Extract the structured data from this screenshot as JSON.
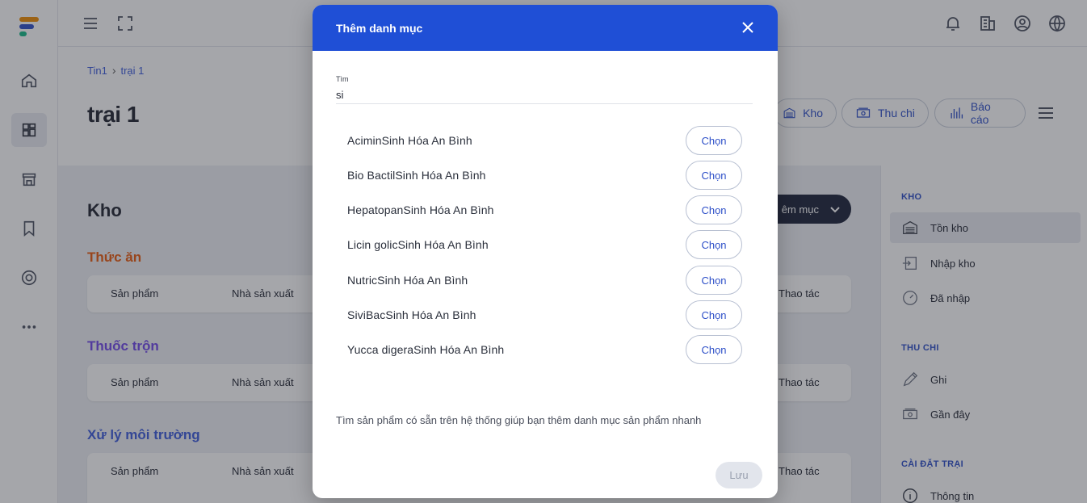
{
  "topbar": {
    "icons": [
      "menu-icon",
      "fullscreen-icon",
      "bell-icon",
      "building-icon",
      "user-circle-icon",
      "globe-icon"
    ]
  },
  "rail": {
    "icons": [
      "home-icon",
      "dashboard-icon",
      "store-icon",
      "bookmark-icon",
      "support-icon",
      "more-icon"
    ]
  },
  "breadcrumb": {
    "root": "Tin1",
    "current": "trại 1"
  },
  "page": {
    "title": "trại 1"
  },
  "tabs": [
    {
      "label": "Kho",
      "icon": "warehouse-icon"
    },
    {
      "label": "Thu chi",
      "icon": "money-icon"
    },
    {
      "label": "Báo cáo",
      "icon": "chart-icon"
    }
  ],
  "main": {
    "section_title": "Kho",
    "add_button": "êm mục",
    "categories": [
      {
        "title": "Thức ăn",
        "color": "#e8590c"
      },
      {
        "title": "Thuốc trộn",
        "color": "#7048e8"
      },
      {
        "title": "Xử lý môi trường",
        "color": "#3b5bdb"
      }
    ],
    "columns": {
      "product": "Sản phẩm",
      "maker": "Nhà sản xuất",
      "actions": "Thao tác"
    }
  },
  "right_panel": {
    "groups": [
      {
        "title": "KHO",
        "items": [
          "Tồn kho",
          "Nhập kho",
          "Đã nhập"
        ]
      },
      {
        "title": "THU CHI",
        "items": [
          "Ghi",
          "Gần đây"
        ]
      },
      {
        "title": "CÀI ĐẶT TRẠI",
        "items": [
          "Thông tin"
        ]
      }
    ]
  },
  "modal": {
    "title": "Thêm danh mục",
    "search_label": "Tìm",
    "search_value": "si",
    "choose_label": "Chọn",
    "results": [
      "AciminSinh Hóa An Bình",
      "Bio BactilSinh Hóa An Bình",
      "HepatopanSinh Hóa An Bình",
      "Licin golicSinh Hóa An Bình",
      "NutricSinh Hóa An Bình",
      "SiviBacSinh Hóa An Bình",
      "Yucca digeraSinh Hóa An Bình"
    ],
    "hint": "Tìm sản phẩm có sẵn trên hệ thống giúp bạn thêm danh mục sản phẩm nhanh",
    "save_label": "Lưu"
  },
  "colors": {
    "primary": "#1f4fd6",
    "dark": "#1a2238"
  }
}
